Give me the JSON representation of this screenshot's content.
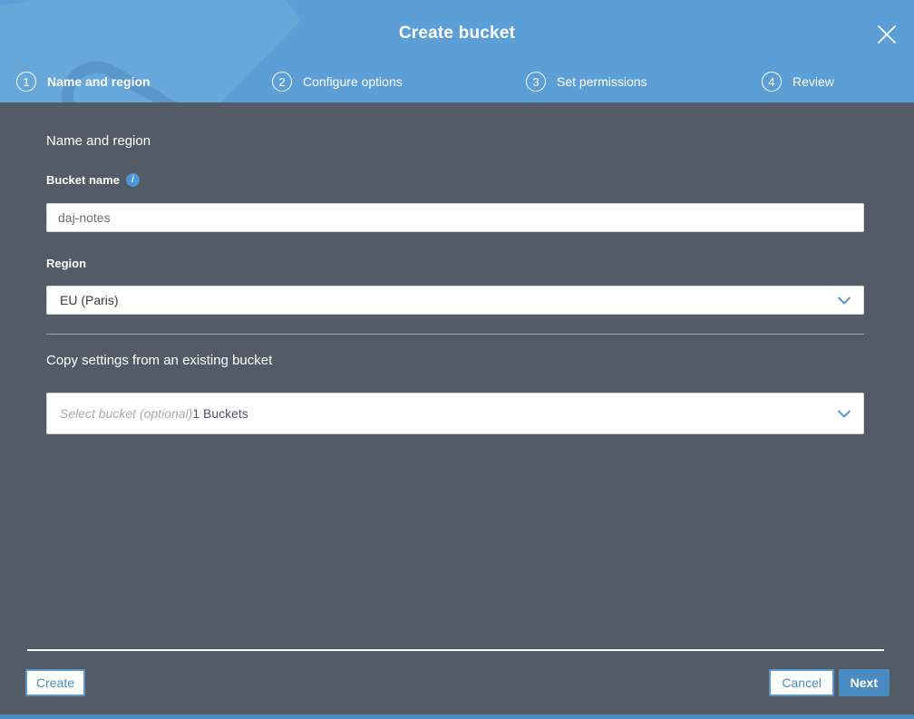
{
  "header": {
    "title": "Create bucket",
    "close_icon": "✕",
    "steps": [
      {
        "number": "1",
        "label": "Name and region",
        "active": true
      },
      {
        "number": "2",
        "label": "Configure options",
        "active": false
      },
      {
        "number": "3",
        "label": "Set permissions",
        "active": false
      },
      {
        "number": "4",
        "label": "Review",
        "active": false
      }
    ]
  },
  "form": {
    "section_title": "Name and region",
    "bucket_name": {
      "label": "Bucket name",
      "info_icon": "i",
      "value": "daj-notes"
    },
    "region": {
      "label": "Region",
      "value": "EU (Paris)"
    },
    "copy_settings": {
      "title": "Copy settings from an existing bucket",
      "placeholder": "Select bucket (optional)",
      "count_text": "1 Buckets"
    }
  },
  "footer": {
    "create_label": "Create",
    "cancel_label": "Cancel",
    "next_label": "Next"
  },
  "colors": {
    "header_blue": "#5C9ED6",
    "watermark_blue": "#67A7DA",
    "body_slate": "#535C66",
    "accent_blue": "#4A8BC2",
    "info_icon_blue": "#4E95D4",
    "input_text_gray": "#687078",
    "placeholder_gray": "#A5ABB1"
  }
}
